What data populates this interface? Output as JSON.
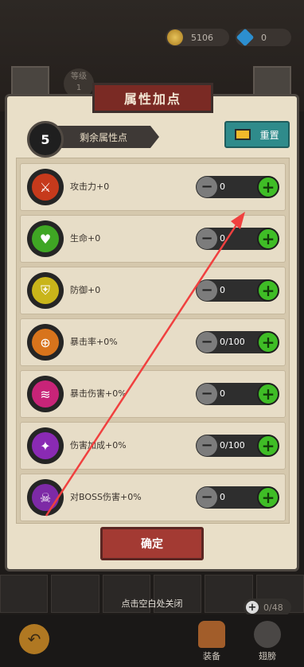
{
  "header": {
    "gold": "5106",
    "gems": "0",
    "level_label": "等级",
    "level_value": "1"
  },
  "dialog": {
    "title": "属性加点",
    "points_value": "5",
    "points_label": "剩余属性点",
    "reset_label": "重置",
    "attributes": [
      {
        "label": "攻击力+0",
        "value": "0",
        "color": "#c63a1c",
        "icon": "sword-icon"
      },
      {
        "label": "生命+0",
        "value": "0",
        "color": "#3fa624",
        "icon": "heart-icon"
      },
      {
        "label": "防御+0",
        "value": "0",
        "color": "#c9b51a",
        "icon": "shield-icon"
      },
      {
        "label": "暴击率+0%",
        "value": "0/100",
        "color": "#d8741c",
        "icon": "crosshair-icon"
      },
      {
        "label": "暴击伤害+0%",
        "value": "0",
        "color": "#c82478",
        "icon": "claw-icon"
      },
      {
        "label": "伤害加成+0%",
        "value": "0/100",
        "color": "#8a2ab4",
        "icon": "boots-icon"
      },
      {
        "label": "对BOSS伤害+0%",
        "value": "0",
        "color": "#7d2aa6",
        "icon": "demon-skull-icon"
      }
    ],
    "confirm_label": "确定"
  },
  "close_hint": "点击空白处关闭",
  "inventory": {
    "count": "0/48"
  },
  "bottom_nav": [
    {
      "label": "装备",
      "icon": "helmet-icon"
    },
    {
      "label": "翅膀",
      "icon": "wings-icon"
    }
  ],
  "colors": {
    "accent_green": "#3fbd26",
    "banner_red": "#7a2a24",
    "reset_teal": "#2f8b8b",
    "arrow_red": "#f0403f"
  }
}
